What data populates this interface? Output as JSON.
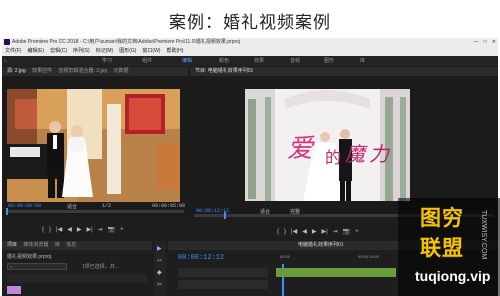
{
  "banner": {
    "title": "案例：婚礼视频案例"
  },
  "window": {
    "title": "Adobe Premiere Pro CC 2018 - C:\\用户\\xuman\\我的文档\\Adobe\\Premiere Pro\\11.0\\婚礼视频效果.prproj",
    "minimize": "—",
    "maximize": "□",
    "close": "✕"
  },
  "menu": [
    "文件(F)",
    "编辑(E)",
    "剪辑(C)",
    "序列(S)",
    "标记(M)",
    "图形(G)",
    "窗口(W)",
    "帮助(H)"
  ],
  "workspaces": [
    "学习",
    "组件",
    "编辑",
    "颜色",
    "效果",
    "音频",
    "图形",
    "库"
  ],
  "source_panel": {
    "tabs": [
      "源: 2.jpg",
      "效果控件",
      "音频剪辑混合器: 2.jpg",
      "元数据"
    ],
    "timecode": "00:00:00:00",
    "fit": "适合",
    "fraction": "1/2",
    "duration": "00:00:05:00"
  },
  "program_panel": {
    "tabs": [
      "节目: 电脑婚礼效果序列01"
    ],
    "timecode": "00:00:12:12",
    "fit": "适合",
    "fraction": "完整"
  },
  "controls": [
    "{",
    "}",
    "|◀",
    "◀",
    "▶",
    "▶|",
    "⇥",
    "📷",
    "+"
  ],
  "project_panel": {
    "tabs": [
      "项目",
      "媒体浏览器",
      "库",
      "信息"
    ],
    "title": "婚礼视频效果.prproj",
    "search_placeholder": "(1/2)",
    "count": "1项已选择，共..."
  },
  "tools": [
    "▶",
    "⇿",
    "◆",
    "✂"
  ],
  "timeline": {
    "tab": "电脑婚礼效果序列01",
    "timecode": "00:00:12:12",
    "ruler": [
      "00:00",
      "00:00:15:00",
      "00:00:30:00"
    ]
  },
  "watermark": {
    "line1": "图穷",
    "line2": "联盟",
    "url": "tuqiong.vip",
    "side": "TUXWISY.COM"
  },
  "photo_text": {
    "title_art": "爱的魔力"
  }
}
